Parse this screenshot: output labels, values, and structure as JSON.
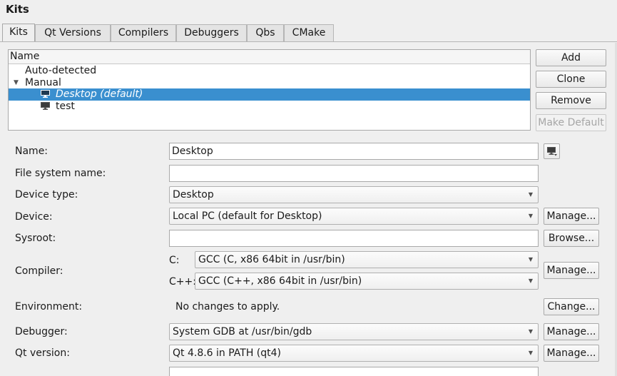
{
  "page_title": "Kits",
  "tabs": [
    {
      "label": "Kits",
      "active": true
    },
    {
      "label": "Qt Versions"
    },
    {
      "label": "Compilers"
    },
    {
      "label": "Debuggers"
    },
    {
      "label": "Qbs"
    },
    {
      "label": "CMake"
    }
  ],
  "tree": {
    "header": "Name",
    "items": [
      {
        "label": "Auto-detected"
      },
      {
        "label": "Manual"
      },
      {
        "label": "Desktop (default)",
        "icon": "monitor-icon"
      },
      {
        "label": "test",
        "icon": "monitor-icon"
      }
    ]
  },
  "side_buttons": {
    "add": "Add",
    "clone": "Clone",
    "remove": "Remove",
    "make_default": "Make Default"
  },
  "form": {
    "name": {
      "label": "Name:",
      "value": "Desktop"
    },
    "fs_name": {
      "label": "File system name:",
      "value": ""
    },
    "device_type": {
      "label": "Device type:",
      "value": "Desktop"
    },
    "device": {
      "label": "Device:",
      "value": "Local PC (default for Desktop)",
      "button": "Manage..."
    },
    "sysroot": {
      "label": "Sysroot:",
      "value": "",
      "button": "Browse..."
    },
    "compiler": {
      "label": "Compiler:",
      "c_label": "C:",
      "c_value": "GCC (C, x86 64bit in /usr/bin)",
      "cpp_label": "C++:",
      "cpp_value": "GCC (C++, x86 64bit in /usr/bin)",
      "button": "Manage..."
    },
    "environment": {
      "label": "Environment:",
      "value": "No changes to apply.",
      "button": "Change..."
    },
    "debugger": {
      "label": "Debugger:",
      "value": "System GDB at /usr/bin/gdb",
      "button": "Manage..."
    },
    "qt_version": {
      "label": "Qt version:",
      "value": "Qt 4.8.6 in PATH (qt4)",
      "button": "Manage..."
    }
  },
  "colors": {
    "selection": "#3a8fcf",
    "background": "#efefef"
  }
}
